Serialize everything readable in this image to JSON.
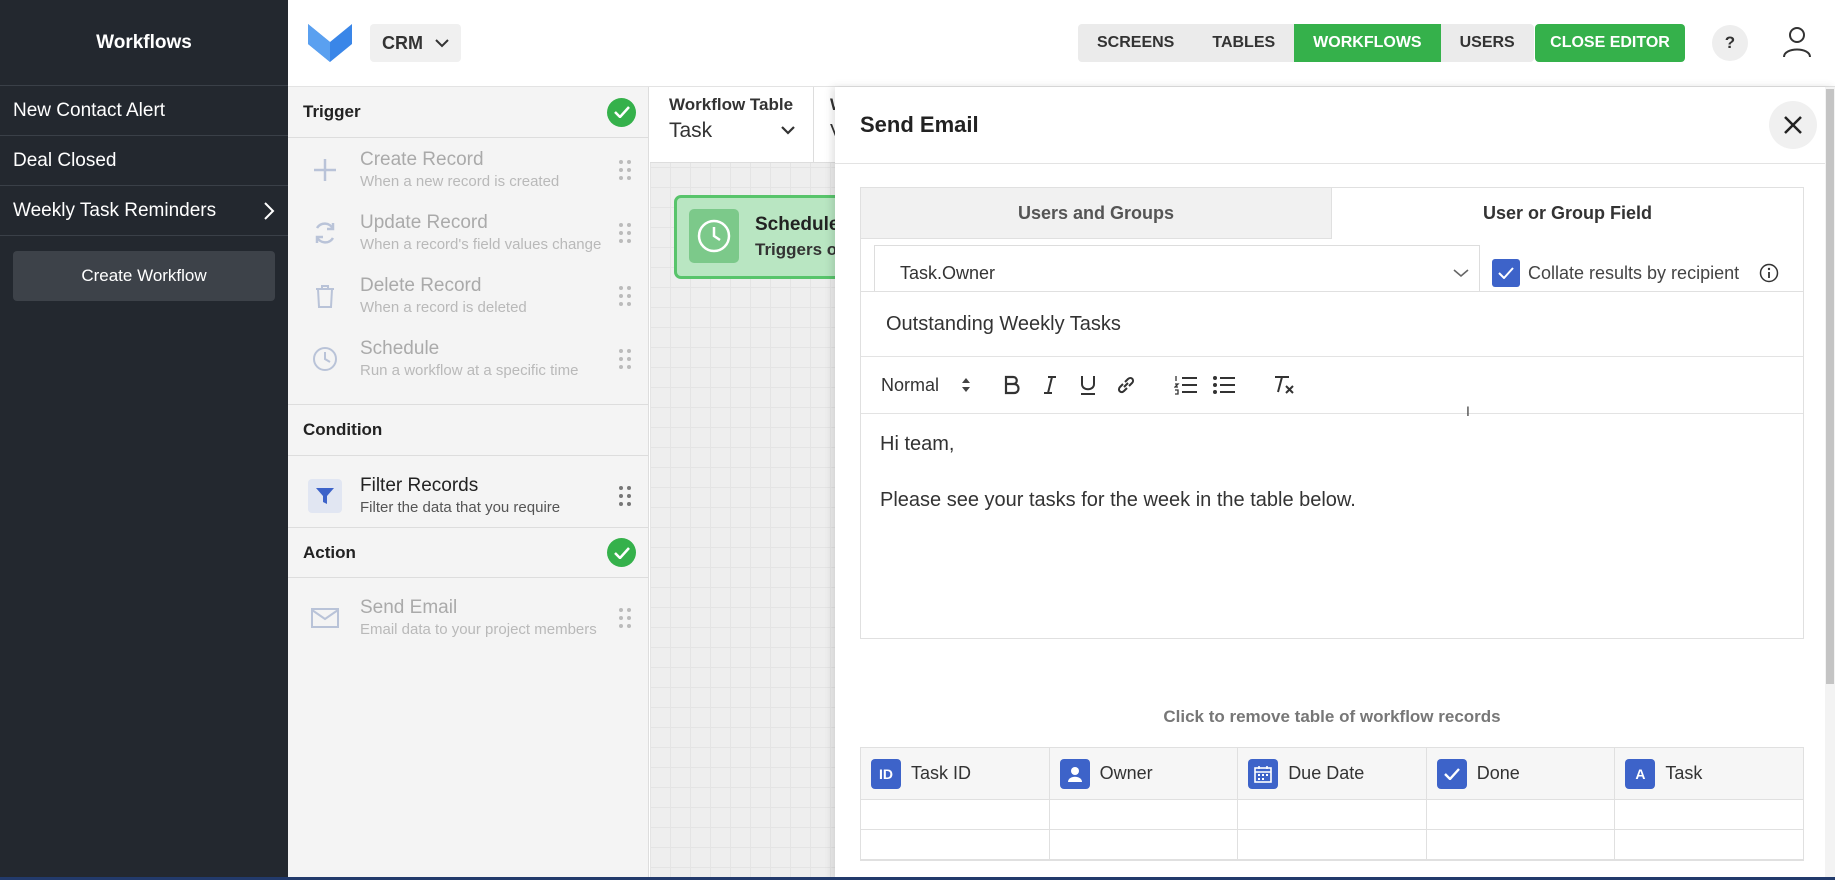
{
  "sidebar": {
    "title": "Workflows",
    "items": [
      {
        "label": "New Contact Alert"
      },
      {
        "label": "Deal Closed"
      },
      {
        "label": "Weekly Task Reminders"
      }
    ],
    "create_label": "Create Workflow"
  },
  "topbar": {
    "app_selector": "CRM",
    "nav": [
      {
        "label": "SCREENS",
        "active": false
      },
      {
        "label": "TABLES",
        "active": false
      },
      {
        "label": "WORKFLOWS",
        "active": true
      },
      {
        "label": "USERS",
        "active": false
      }
    ],
    "close_editor_label": "CLOSE EDITOR",
    "help_label": "?"
  },
  "panel": {
    "trigger_heading": "Trigger",
    "triggers": [
      {
        "title": "Create Record",
        "desc": "When a new record is created",
        "icon": "plus-icon"
      },
      {
        "title": "Update Record",
        "desc": "When a record's field values change",
        "icon": "refresh-icon"
      },
      {
        "title": "Delete Record",
        "desc": "When a record is deleted",
        "icon": "trash-icon"
      },
      {
        "title": "Schedule",
        "desc": "Run a workflow at a specific time",
        "icon": "clock-icon"
      }
    ],
    "condition_heading": "Condition",
    "condition": {
      "title": "Filter Records",
      "desc": "Filter the data that you require",
      "icon": "filter-icon"
    },
    "action_heading": "Action",
    "action": {
      "title": "Send Email",
      "desc": "Email data to your project members",
      "icon": "mail-icon"
    }
  },
  "canvas": {
    "table_label": "Workflow Table",
    "table_value": "Task",
    "second_label_partial": "W",
    "second_value_partial": "V",
    "node_title": "Schedule",
    "node_subtitle": "Triggers on"
  },
  "drawer": {
    "title": "Send Email",
    "tabs": [
      {
        "label": "Users and Groups",
        "active": false
      },
      {
        "label": "User or Group Field",
        "active": true
      }
    ],
    "recipient_field": "Task.Owner",
    "collate_label": "Collate results by recipient",
    "collate_checked": true,
    "subject": "Outstanding Weekly Tasks",
    "format_select": "Normal",
    "body_lines": [
      "Hi team,",
      "Please see your tasks for the week in the table below."
    ],
    "table_hint": "Click to remove table of workflow records",
    "table_columns": [
      {
        "label": "Task ID",
        "icon_text": "ID",
        "icon": "id-icon"
      },
      {
        "label": "Owner",
        "icon_text": "",
        "icon": "person-icon"
      },
      {
        "label": "Due Date",
        "icon_text": "",
        "icon": "calendar-icon"
      },
      {
        "label": "Done",
        "icon_text": "",
        "icon": "checkbox-icon"
      },
      {
        "label": "Task",
        "icon_text": "A",
        "icon": "text-icon"
      }
    ]
  },
  "colors": {
    "sidebar_bg": "#23282f",
    "accent_green": "#35b14b",
    "accent_blue": "#3d63c9"
  }
}
